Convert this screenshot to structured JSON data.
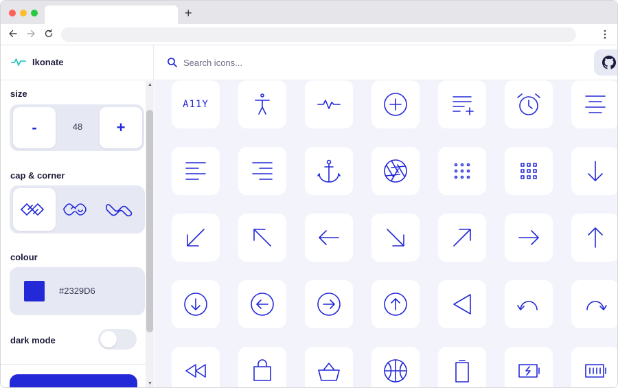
{
  "browser": {
    "tab_title": "",
    "new_tab_label": "+",
    "url": ""
  },
  "app": {
    "name": "Ikonate",
    "accent_color": "#2329D6"
  },
  "sidebar": {
    "size": {
      "label": "size",
      "decrement_label": "-",
      "value": "48",
      "increment_label": "+"
    },
    "cap_corner": {
      "label": "cap & corner",
      "options": [
        "square-miter",
        "round-round",
        "round-miter"
      ],
      "selected_index": 0
    },
    "colour": {
      "label": "colour",
      "value": "#2329D6"
    },
    "dark_mode": {
      "label": "dark mode",
      "enabled": false
    }
  },
  "search": {
    "placeholder": "Search icons...",
    "value": ""
  },
  "header": {
    "github_icon": "github-icon"
  },
  "icons": [
    [
      "a11y",
      "accessibility",
      "activity",
      "add",
      "add-to-list",
      "alarm",
      "align-center"
    ],
    [
      "align-left",
      "align-right",
      "anchor",
      "aperture",
      "apps-alt",
      "apps",
      "arrow-down"
    ],
    [
      "arrow-down-left",
      "arrow-up-left",
      "arrow-left",
      "arrow-down-right",
      "arrow-up-right",
      "arrow-right",
      "arrow-up"
    ],
    [
      "arrow-down-circle",
      "arrow-left-circle",
      "arrow-right-circle",
      "arrow-up-circle",
      "back",
      "undo",
      "redo"
    ],
    [
      "rewind",
      "bag",
      "basket",
      "basketball",
      "battery",
      "battery-charging",
      "battery-full"
    ]
  ],
  "a11y_text": "A11Y"
}
